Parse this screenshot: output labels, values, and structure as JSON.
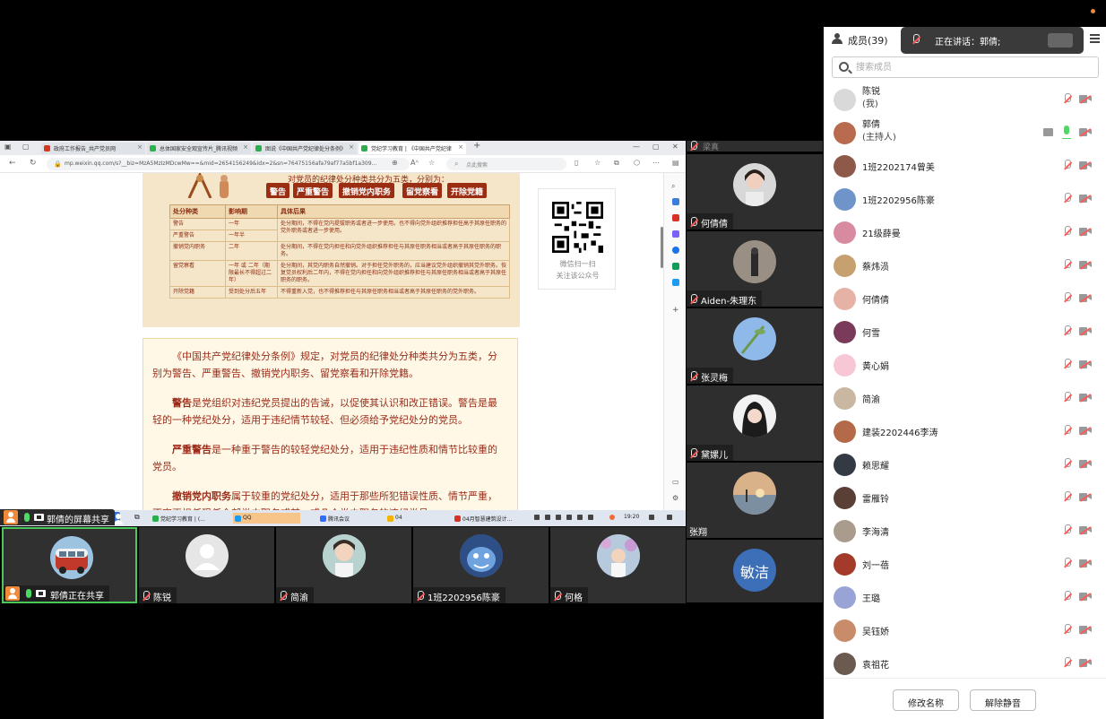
{
  "window": {
    "recording_dot_color": "#f08a3a"
  },
  "browser": {
    "tabs": [
      {
        "label": "政府工作报告_共产党员网",
        "color": "#d4381e"
      },
      {
        "label": "总体国家安全观宣传片_腾讯视频",
        "color": "#27b24a"
      },
      {
        "label": "图说《中国共产党纪律处分条例》",
        "color": "#2aae4a"
      },
      {
        "label": "党纪学习教育 | 《中国共产党纪律",
        "color": "#2aae4a"
      }
    ],
    "new_tab": "+",
    "url": "mp.weixin.qq.com/s?__biz=MzA5MzIzMDcwMw==&mid=2654156249&idx=2&sn=76475156afa79af77a5bf1a309...",
    "search_placeholder": "点此搜索",
    "zoom_icon": "Aᴬ",
    "article": {
      "infographic_header": "对党员的纪律处分种类共分为五类，分别为：",
      "categories": [
        "警告",
        "严重警告",
        "撤销党内职务",
        "留党察看",
        "开除党籍"
      ],
      "table_headers": [
        "处分种类",
        "影响期",
        "具体后果"
      ],
      "table_rows": [
        [
          "警告",
          "一年",
          "处分期间，不得在党内提拔职务或者进一步使用。也不得向党外组织推荐担任高于其原任职务的党外职务或者进一步使用。"
        ],
        [
          "严重警告",
          "一年半",
          ""
        ],
        [
          "撤销党内职务",
          "二年",
          "处分期间，不得在党内担任和向党外组织推荐担任与其原任职务相当或者高于其原任职务的职务。"
        ],
        [
          "留党察看",
          "一年 或 二年（期限最长不得超过二年）",
          "处分期间，其党内职务自然撤销。对于担任党外职务的，应当建议党外组织撤销其党外职务。恢复党员权利后二年内，不得在党内担任和向党外组织推荐担任与其原任职务相当或者高于其原任职务的职务。"
        ],
        [
          "开除党籍",
          "受到处分后五年",
          "不得重新入党，也不得推荐担任与其原任职务相当或者高于其原任职务的党外职务。"
        ]
      ],
      "p1": "《中国共产党纪律处分条例》规定，对党员的纪律处分种类共分为五类，分别为警告、严重警告、撤销党内职务、留党察看和开除党籍。",
      "p2_bold": "警告",
      "p2": "是党组织对违纪党员提出的告诫，以促使其认识和改正错误。警告是最轻的一种党纪处分，适用于违纪情节较轻、但必须给予党纪处分的党员。",
      "p3_bold": "严重警告",
      "p3": "是一种重于警告的较轻党纪处分，适用于违纪性质和情节比较重的党员。",
      "p4_bold": "撤销党内职务",
      "p4": "属于较重的党纪处分，适用于那些所犯错误性质、情节严重，不宜再担任现任全部党内职务或某一或几个党内职务的违纪党员。",
      "qr_line1": "微信扫一扫",
      "qr_line2": "关注该公众号"
    },
    "taskbar": {
      "items": [
        {
          "label": "党纪学习教育 | (...",
          "color": "#2aae4a"
        },
        {
          "label": "QQ",
          "color": "#1d9bf0"
        },
        {
          "label": "腾讯会议",
          "color": "#2f6bff"
        },
        {
          "label": "04",
          "color": "#f4b400"
        },
        {
          "label": "04月智慧建筑设计...",
          "color": "#d93025"
        }
      ],
      "clock": "19:20"
    }
  },
  "share_label": "郭倩的屏幕共享",
  "bottom_tiles": [
    {
      "name": "郭倩正在共享",
      "active": true
    },
    {
      "name": "陈锐"
    },
    {
      "name": "简渝"
    },
    {
      "name": "1班2202956陈豪"
    },
    {
      "name": "何格"
    }
  ],
  "side_tiles": {
    "top_label": "梁真",
    "tiles": [
      {
        "name": "何倩倩"
      },
      {
        "name": "Aiden-朱理东"
      },
      {
        "name": "张灵梅"
      },
      {
        "name": "黛嫘儿"
      },
      {
        "name": "张翔"
      },
      {
        "name": "敏洁",
        "text_avatar": "敏洁"
      }
    ]
  },
  "panel": {
    "title": "成员(39)",
    "speaking": "正在讲话：郭倩;",
    "search_placeholder": "搜索成员",
    "members": [
      {
        "name": "陈锐",
        "role": "(我)"
      },
      {
        "name": "郭倩",
        "role": "(主持人)",
        "mic_on": true,
        "sharing": true
      },
      {
        "name": "1班2202174曾美"
      },
      {
        "name": "1班2202956陈豪"
      },
      {
        "name": "21级薛曼"
      },
      {
        "name": "蔡炜涢"
      },
      {
        "name": "何倩倩"
      },
      {
        "name": "何雪"
      },
      {
        "name": "黄心娟"
      },
      {
        "name": "简渝"
      },
      {
        "name": "建装2202446李涛"
      },
      {
        "name": "赖思耀"
      },
      {
        "name": "雷雁铃"
      },
      {
        "name": "李海清"
      },
      {
        "name": "刘一蓓"
      },
      {
        "name": "王璐"
      },
      {
        "name": "吴钰娇"
      },
      {
        "name": "袁祖花"
      }
    ],
    "rename_button": "修改名称",
    "unmute_button": "解除静音"
  }
}
